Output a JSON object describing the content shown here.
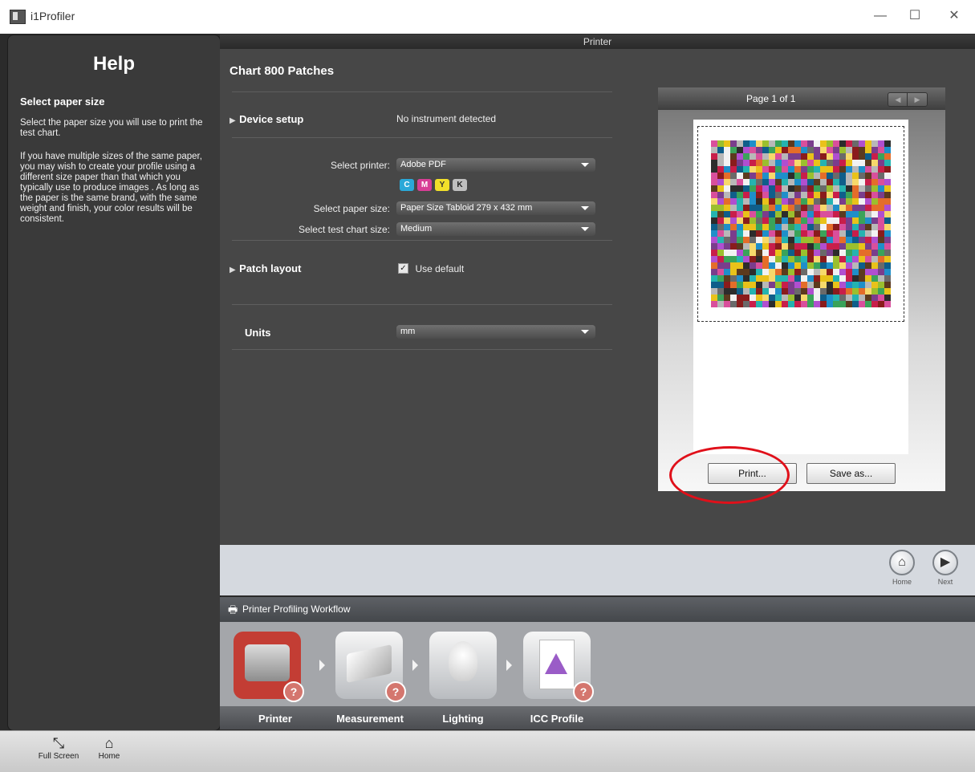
{
  "window": {
    "title": "i1Profiler",
    "minimize": "—",
    "maximize": "☐",
    "close": "✕"
  },
  "help": {
    "title": "Help",
    "subtitle": "Select paper size",
    "para1": "Select the paper size you will use to print the test chart.",
    "para2": "If you have multiple sizes of the same paper, you may wish to create your profile using a different size paper than that which you typically use to produce images . As long as the paper is the same brand, with the same weight and finish, your color results will be consistent."
  },
  "main": {
    "header": "Printer",
    "chart_title": "Chart 800 Patches",
    "device_setup": {
      "label": "Device setup",
      "status": "No instrument detected"
    },
    "printer": {
      "label": "Select printer:",
      "value": "Adobe PDF"
    },
    "inks": [
      "C",
      "M",
      "Y",
      "K"
    ],
    "paper": {
      "label": "Select paper size:",
      "value": "Paper Size Tabloid  279 x 432 mm"
    },
    "chart_size": {
      "label": "Select test chart size:",
      "value": "Medium"
    },
    "patch_layout": {
      "label": "Patch layout",
      "checkbox_label": "Use default",
      "checked": true
    },
    "units": {
      "label": "Units",
      "value": "mm"
    }
  },
  "preview": {
    "page_label": "Page 1 of 1",
    "print_button": "Print...",
    "save_button": "Save as..."
  },
  "nav": {
    "home_label": "Home",
    "next_label": "Next"
  },
  "workflow": {
    "title": "Printer Profiling Workflow",
    "steps": [
      {
        "label": "Printer",
        "active": true
      },
      {
        "label": "Measurement",
        "active": false
      },
      {
        "label": "Lighting",
        "active": false
      },
      {
        "label": "ICC Profile",
        "active": false
      }
    ]
  },
  "bottombar": {
    "fullscreen_label": "Full Screen",
    "home_label": "Home"
  },
  "colors": {
    "accent_red": "#e0101a",
    "active_step": "#c33d34"
  }
}
